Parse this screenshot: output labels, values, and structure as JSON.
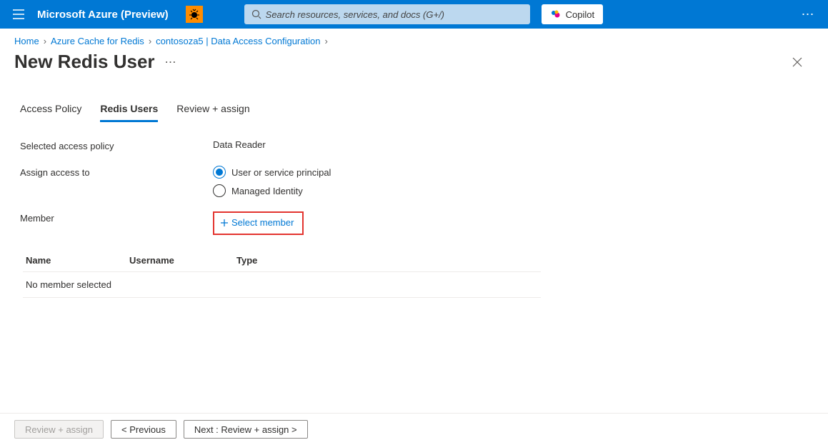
{
  "header": {
    "brand": "Microsoft Azure (Preview)",
    "search_placeholder": "Search resources, services, and docs (G+/)",
    "copilot_label": "Copilot"
  },
  "breadcrumb": {
    "items": [
      "Home",
      "Azure Cache for Redis",
      "contosoza5 | Data Access Configuration"
    ]
  },
  "page": {
    "title": "New Redis User"
  },
  "tabs": {
    "items": [
      {
        "label": "Access Policy",
        "active": false
      },
      {
        "label": "Redis Users",
        "active": true
      },
      {
        "label": "Review + assign",
        "active": false
      }
    ]
  },
  "form": {
    "selected_policy_label": "Selected access policy",
    "selected_policy_value": "Data Reader",
    "assign_label": "Assign access to",
    "radio_user": "User or service principal",
    "radio_managed": "Managed Identity",
    "member_label": "Member",
    "select_member": "Select member"
  },
  "table": {
    "col_name": "Name",
    "col_username": "Username",
    "col_type": "Type",
    "empty": "No member selected"
  },
  "footer": {
    "review": "Review + assign",
    "previous": "< Previous",
    "next": "Next : Review + assign >"
  }
}
